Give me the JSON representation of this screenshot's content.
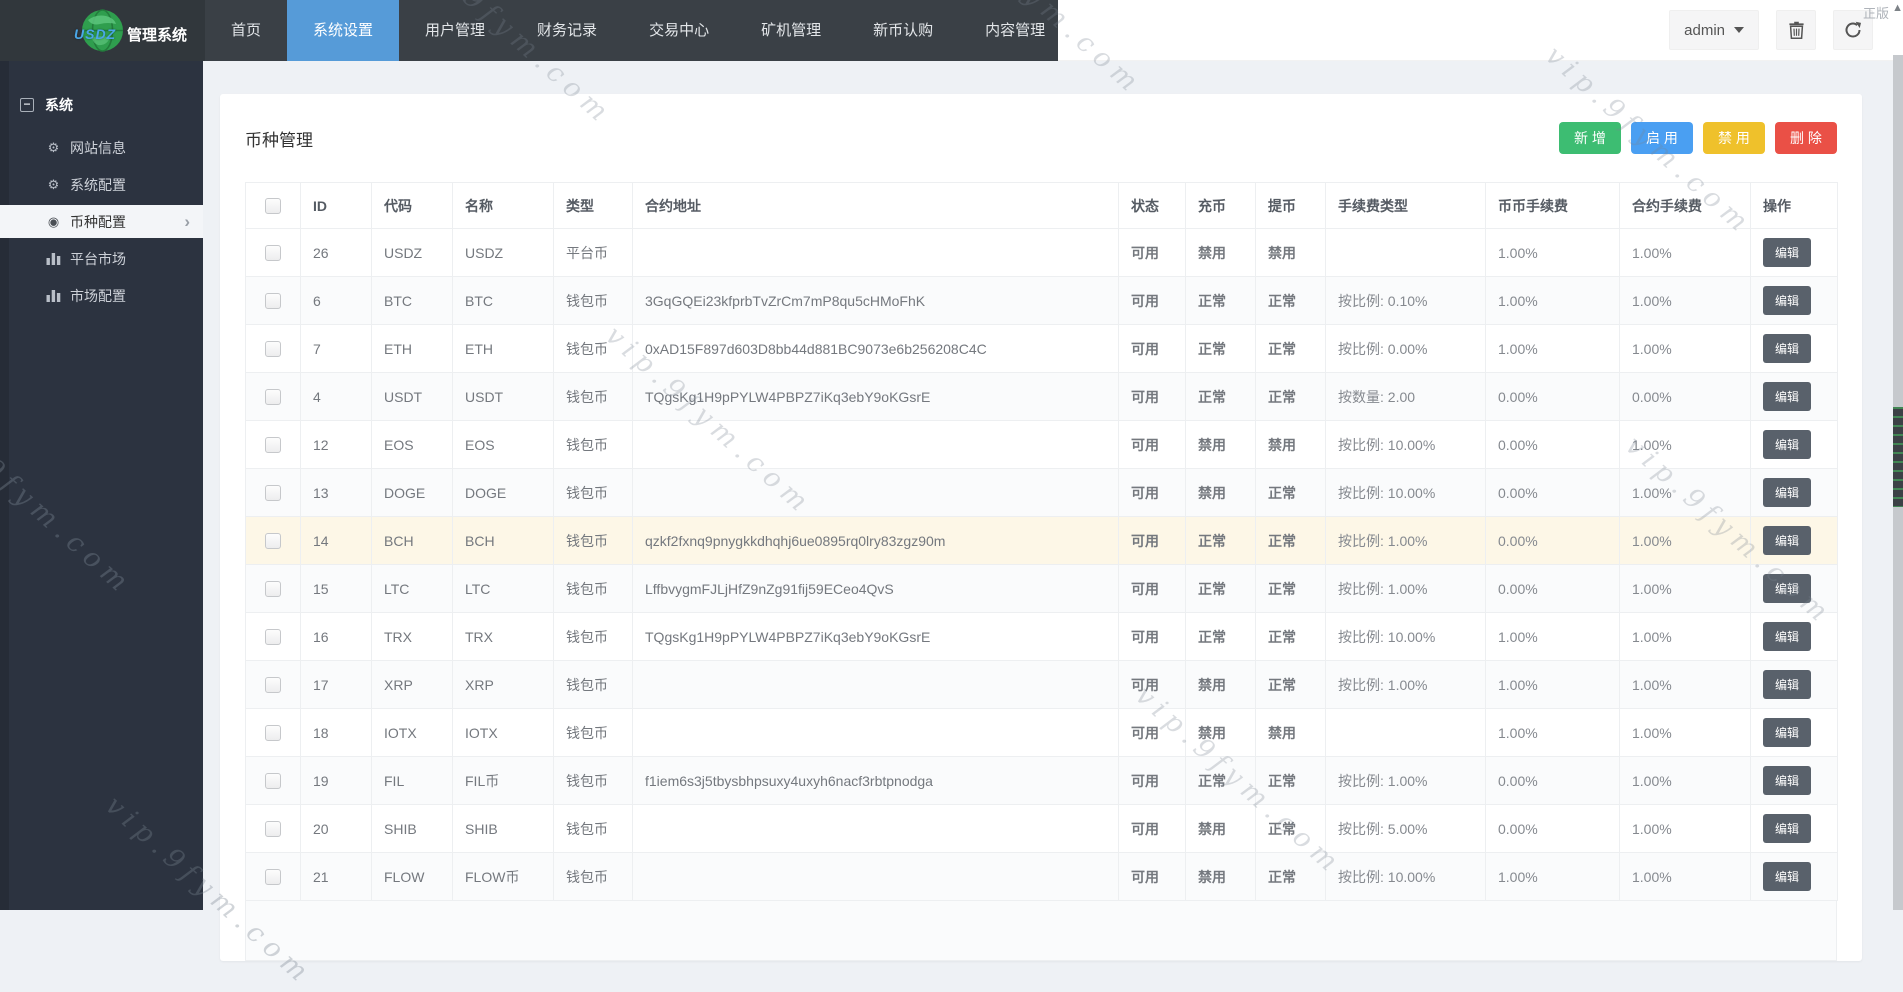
{
  "navbar": {
    "logo_text": "USDZ",
    "logo_title": "管理系统",
    "tabs": [
      {
        "label": "首页",
        "active": false
      },
      {
        "label": "系统设置",
        "active": true
      },
      {
        "label": "用户管理",
        "active": false
      },
      {
        "label": "财务记录",
        "active": false
      },
      {
        "label": "交易中心",
        "active": false
      },
      {
        "label": "矿机管理",
        "active": false
      },
      {
        "label": "新币认购",
        "active": false
      },
      {
        "label": "内容管理",
        "active": false
      }
    ],
    "user_label": "admin"
  },
  "sidebar": {
    "section_label": "系统",
    "items": [
      {
        "label": "网站信息",
        "icon": "gear-icon",
        "active": false
      },
      {
        "label": "系统配置",
        "icon": "gear-icon",
        "active": false
      },
      {
        "label": "币种配置",
        "icon": "target-icon",
        "active": true
      },
      {
        "label": "平台市场",
        "icon": "bar-chart-icon",
        "active": false
      },
      {
        "label": "市场配置",
        "icon": "bar-chart-icon",
        "active": false
      }
    ]
  },
  "page": {
    "title": "币种管理",
    "actions": {
      "add": "新 增",
      "enable": "启 用",
      "disable": "禁 用",
      "delete": "删 除"
    }
  },
  "table": {
    "columns": [
      "ID",
      "代码",
      "名称",
      "类型",
      "合约地址",
      "状态",
      "充币",
      "提币",
      "手续费类型",
      "币币手续费",
      "合约手续费",
      "操作"
    ],
    "edit_label": "编辑",
    "rows": [
      {
        "id": "26",
        "code": "USDZ",
        "name": "USDZ",
        "type": "平台币",
        "address": "",
        "status": "可用",
        "deposit": "禁用",
        "withdraw": "禁用",
        "fee_type": "",
        "coin_fee": "1.00%",
        "contract_fee": "1.00%",
        "highlight": false
      },
      {
        "id": "6",
        "code": "BTC",
        "name": "BTC",
        "type": "钱包币",
        "address": "3GqGQEi23kfprbTvZrCm7mP8qu5cHMoFhK",
        "status": "可用",
        "deposit": "正常",
        "withdraw": "正常",
        "fee_type": "按比例: 0.10%",
        "coin_fee": "1.00%",
        "contract_fee": "1.00%",
        "highlight": false
      },
      {
        "id": "7",
        "code": "ETH",
        "name": "ETH",
        "type": "钱包币",
        "address": "0xAD15F897d603D8bb44d881BC9073e6b256208C4C",
        "status": "可用",
        "deposit": "正常",
        "withdraw": "正常",
        "fee_type": "按比例: 0.00%",
        "coin_fee": "1.00%",
        "contract_fee": "1.00%",
        "highlight": false
      },
      {
        "id": "4",
        "code": "USDT",
        "name": "USDT",
        "type": "钱包币",
        "address": "TQgsKg1H9pPYLW4PBPZ7iKq3ebY9oKGsrE",
        "status": "可用",
        "deposit": "正常",
        "withdraw": "正常",
        "fee_type": "按数量: 2.00",
        "coin_fee": "0.00%",
        "contract_fee": "0.00%",
        "highlight": false
      },
      {
        "id": "12",
        "code": "EOS",
        "name": "EOS",
        "type": "钱包币",
        "address": "",
        "status": "可用",
        "deposit": "禁用",
        "withdraw": "禁用",
        "fee_type": "按比例: 10.00%",
        "coin_fee": "0.00%",
        "contract_fee": "1.00%",
        "highlight": false
      },
      {
        "id": "13",
        "code": "DOGE",
        "name": "DOGE",
        "type": "钱包币",
        "address": "",
        "status": "可用",
        "deposit": "禁用",
        "withdraw": "正常",
        "fee_type": "按比例: 10.00%",
        "coin_fee": "0.00%",
        "contract_fee": "1.00%",
        "highlight": false
      },
      {
        "id": "14",
        "code": "BCH",
        "name": "BCH",
        "type": "钱包币",
        "address": "qzkf2fxnq9pnygkkdhqhj6ue0895rq0lry83zgz90m",
        "status": "可用",
        "deposit": "正常",
        "withdraw": "正常",
        "fee_type": "按比例: 1.00%",
        "coin_fee": "0.00%",
        "contract_fee": "1.00%",
        "highlight": true
      },
      {
        "id": "15",
        "code": "LTC",
        "name": "LTC",
        "type": "钱包币",
        "address": "LffbvygmFJLjHfZ9nZg91fij59ECeo4QvS",
        "status": "可用",
        "deposit": "正常",
        "withdraw": "正常",
        "fee_type": "按比例: 1.00%",
        "coin_fee": "0.00%",
        "contract_fee": "1.00%",
        "highlight": false
      },
      {
        "id": "16",
        "code": "TRX",
        "name": "TRX",
        "type": "钱包币",
        "address": "TQgsKg1H9pPYLW4PBPZ7iKq3ebY9oKGsrE",
        "status": "可用",
        "deposit": "正常",
        "withdraw": "正常",
        "fee_type": "按比例: 10.00%",
        "coin_fee": "1.00%",
        "contract_fee": "1.00%",
        "highlight": false
      },
      {
        "id": "17",
        "code": "XRP",
        "name": "XRP",
        "type": "钱包币",
        "address": "",
        "status": "可用",
        "deposit": "禁用",
        "withdraw": "正常",
        "fee_type": "按比例: 1.00%",
        "coin_fee": "1.00%",
        "contract_fee": "1.00%",
        "highlight": false
      },
      {
        "id": "18",
        "code": "IOTX",
        "name": "IOTX",
        "type": "钱包币",
        "address": "",
        "status": "可用",
        "deposit": "禁用",
        "withdraw": "禁用",
        "fee_type": "",
        "coin_fee": "1.00%",
        "contract_fee": "1.00%",
        "highlight": false
      },
      {
        "id": "19",
        "code": "FIL",
        "name": "FIL币",
        "type": "钱包币",
        "address": "f1iem6s3j5tbysbhpsuxy4uxyh6nacf3rbtpnodga",
        "status": "可用",
        "deposit": "正常",
        "withdraw": "正常",
        "fee_type": "按比例: 1.00%",
        "coin_fee": "0.00%",
        "contract_fee": "1.00%",
        "highlight": false
      },
      {
        "id": "20",
        "code": "SHIB",
        "name": "SHIB",
        "type": "钱包币",
        "address": "",
        "status": "可用",
        "deposit": "禁用",
        "withdraw": "正常",
        "fee_type": "按比例: 5.00%",
        "coin_fee": "0.00%",
        "contract_fee": "1.00%",
        "highlight": false
      },
      {
        "id": "21",
        "code": "FLOW",
        "name": "FLOW币",
        "type": "钱包币",
        "address": "",
        "status": "可用",
        "deposit": "禁用",
        "withdraw": "正常",
        "fee_type": "按比例: 10.00%",
        "coin_fee": "1.00%",
        "contract_fee": "1.00%",
        "highlight": false
      }
    ]
  },
  "watermark": {
    "text": "vip.9fym.com",
    "corner_label": "正版",
    "corner_glyph": "▲"
  },
  "colors": {
    "active_tab": "#569bd8",
    "add": "#3dbd72",
    "enable": "#4a9ff2",
    "disable": "#efc12b",
    "delete": "#ea5046",
    "status_ok": "#2cab5f",
    "status_forbidden": "#e1332c",
    "edit": "#59616b"
  }
}
